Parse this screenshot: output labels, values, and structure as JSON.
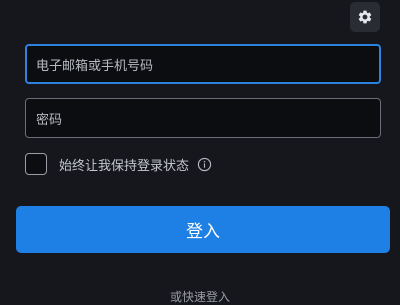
{
  "settings": {
    "icon": "gear-icon"
  },
  "form": {
    "email_placeholder": "电子邮箱或手机号码",
    "password_placeholder": "密码",
    "remember_label": "始终让我保持登录状态",
    "info_icon": "info-icon",
    "login_label": "登入",
    "alt_login_text": "或快速登入"
  },
  "colors": {
    "background": "#16171d",
    "primary_button": "#1e7fe5",
    "focus_border": "#2b83de"
  }
}
